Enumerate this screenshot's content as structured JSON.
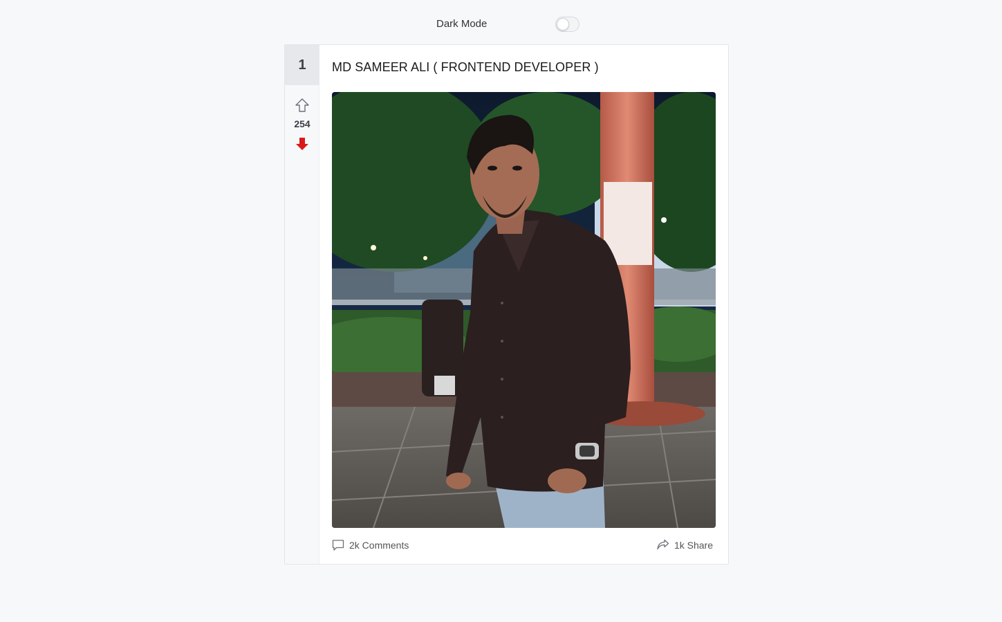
{
  "header": {
    "dark_mode_label": "Dark Mode",
    "dark_mode_enabled": false
  },
  "post": {
    "rank": "1",
    "title": "MD SAMEER ALI ( FRONTEND DEVELOPER )",
    "votes": "254",
    "image_icon": "portrait-photo",
    "comments_label": "2k Comments",
    "share_label": "1k Share"
  },
  "icons": {
    "upvote": "arrow-up-outline-icon",
    "downvote": "arrow-down-filled-icon",
    "comment": "speech-bubble-icon",
    "share": "share-arrow-icon"
  },
  "colors": {
    "downvote_active": "#d91a1a",
    "page_bg": "#f7f8fa"
  }
}
